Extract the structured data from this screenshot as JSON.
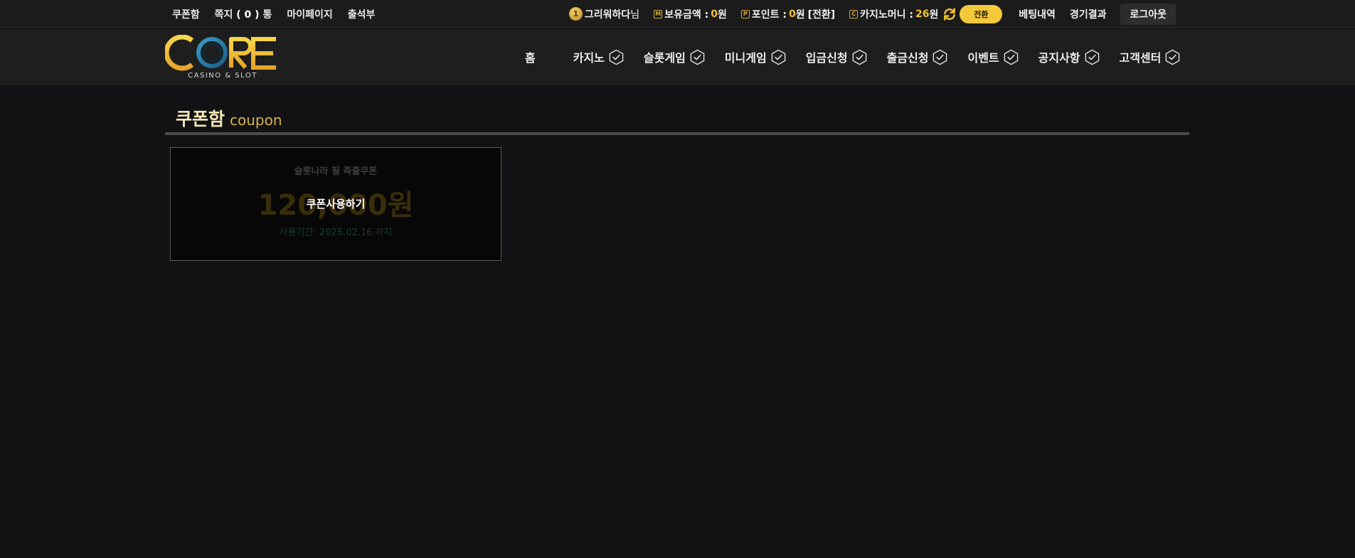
{
  "topbar": {
    "links": {
      "coupon": "쿠폰함",
      "message_prefix": "쪽지",
      "message_count": "( 0 )",
      "message_suffix": "통",
      "mypage": "마이페이지",
      "attendance": "출석부"
    },
    "user": {
      "level_badge": "1",
      "name": "그리워하다",
      "honorific": "님"
    },
    "balance": {
      "badge": "M",
      "label": "보유금액 :",
      "value": "0",
      "unit": "원"
    },
    "points": {
      "badge": "P",
      "label": "포인트 :",
      "value": "0",
      "unit": "원",
      "convert": "[전환]"
    },
    "casino_money": {
      "badge": "C",
      "label": "카지노머니 :",
      "value": "26",
      "unit": "원"
    },
    "switch_label": "전환",
    "betting_history": "베팅내역",
    "game_results": "경기결과",
    "logout": "로그아웃"
  },
  "logo": {
    "text": "CORE",
    "subtitle": "CASINO & SLOT"
  },
  "menu": {
    "items": [
      {
        "label": "홈"
      },
      {
        "label": "카지노"
      },
      {
        "label": "슬롯게임"
      },
      {
        "label": "미니게임"
      },
      {
        "label": "입금신청"
      },
      {
        "label": "출금신청"
      },
      {
        "label": "이벤트"
      },
      {
        "label": "공지사항"
      },
      {
        "label": "고객센터"
      }
    ]
  },
  "page": {
    "title_ko": "쿠폰함",
    "title_en": "coupon"
  },
  "coupon": {
    "name": "슬롯나라 필 즉출쿠폰",
    "amount": "120,000원",
    "period": "사용기간: 2025.02.16 까지",
    "use_label": "쿠폰사용하기"
  },
  "colors": {
    "accent_gold": "#f1c232",
    "switch_button": "#f3c93a",
    "background": "#121214"
  }
}
